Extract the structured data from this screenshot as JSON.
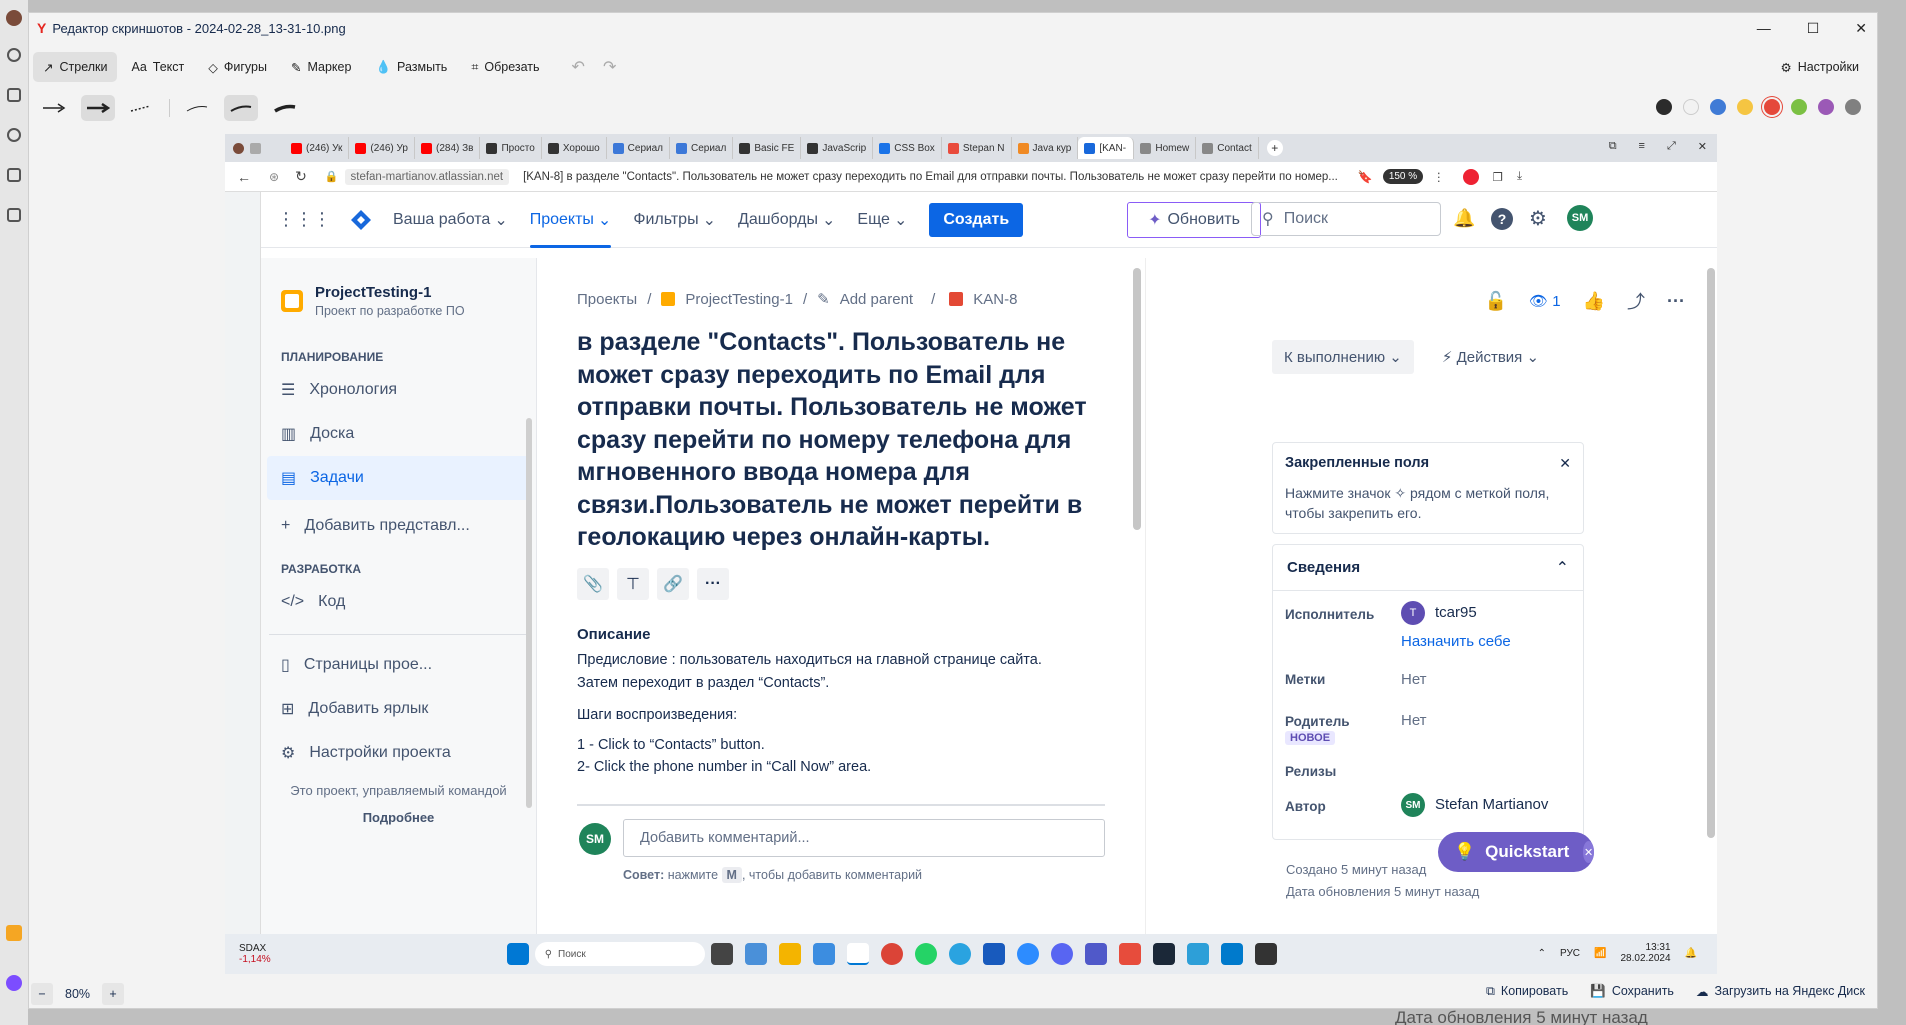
{
  "editor": {
    "title": "Редактор скриншотов - 2024-02-28_13-31-10.png",
    "tools": [
      "Стрелки",
      "Текст",
      "Фигуры",
      "Маркер",
      "Размыть",
      "Обрезать"
    ],
    "settings_label": "Настройки",
    "zoom": "80%",
    "copy_label": "Копировать",
    "save_label": "Сохранить",
    "upload_label": "Загрузить на Яндекс Диск",
    "colors": [
      "#2b2b2b",
      "#f2f2f2",
      "#3f7bd6",
      "#f5c542",
      "#e5483a",
      "#7bc043",
      "#9b59b6",
      "#808080"
    ]
  },
  "browser": {
    "tabs": [
      "(246) Ук",
      "(246) Ур",
      "(284) Зв",
      "Просто",
      "Хорошо",
      "Сериал",
      "Сериал",
      "Basic FE",
      "JavaScrip",
      "CSS Box",
      "Stepan N",
      "Java кур",
      "[KAN-",
      "Homew",
      "Contact"
    ],
    "active_tab": 12,
    "url_host": "stefan-martianov.atlassian.net",
    "url_title": "[KAN-8] в разделе \"Contacts\". Пользователь не может сразу переходить по Email для отправки почты. Пользователь не может сразу перейти по номер...",
    "zoom": "150 %"
  },
  "nav": {
    "your_work": "Ваша работа",
    "projects": "Проекты",
    "filters": "Фильтры",
    "dashboards": "Дашборды",
    "more": "Еще",
    "create": "Создать",
    "upgrade": "Обновить",
    "search_placeholder": "Поиск",
    "avatar": "SM"
  },
  "sidebar": {
    "project_name": "ProjectTesting-1",
    "project_sub": "Проект по разработке ПО",
    "planning": "ПЛАНИРОВАНИЕ",
    "items": [
      "Хронология",
      "Доска",
      "Задачи",
      "Добавить представл..."
    ],
    "dev": "РАЗРАБОТКА",
    "code": "Код",
    "pages": "Страницы прое...",
    "add_shortcut": "Добавить ярлык",
    "settings": "Настройки проекта",
    "team_note": "Это проект, управляемый командой",
    "learn_more": "Подробнее"
  },
  "issue": {
    "crumb_projects": "Проекты",
    "crumb_project": "ProjectTesting-1",
    "crumb_parent": "Add parent",
    "crumb_key": "KAN-8",
    "title": "в разделе \"Contacts\". Пользователь не может сразу переходить по Email для отправки почты. Пользователь не может сразу перейти по номеру телефона для мгновенного ввода номера для связи.Пользователь не может перейти в геолокацию через онлайн-карты.",
    "desc_heading": "Описание",
    "desc_p1": "Предисловие : пользователь находиться на главной странице сайта. Затем переходит в раздел “Contacts”.",
    "desc_p2": "Шаги воспроизведения:",
    "step1": "1 - Click to “Contacts” button.",
    "step2": "2- Click  the phone number in “Call Now” area.",
    "comment_placeholder": "Добавить комментарий...",
    "tip_prefix": "Совет:",
    "tip_mid": " нажмите ",
    "tip_key": "M",
    "tip_suffix": ", чтобы добавить комментарий",
    "avatar": "SM"
  },
  "details": {
    "watch_count": "1",
    "status": "К выполнению",
    "actions": "Действия",
    "pinned_title": "Закрепленные поля",
    "pinned_text": "Нажмите значок ✧ рядом с меткой поля, чтобы закрепить его.",
    "info_title": "Сведения",
    "assignee_label": "Исполнитель",
    "assignee": "tcar95",
    "assignee_avatar": "T",
    "assign_me": "Назначить себе",
    "labels_label": "Метки",
    "labels_val": "Нет",
    "parent_label": "Родитель",
    "new_badge": "НОВОЕ",
    "parent_val": "Нет",
    "releases_label": "Релизы",
    "author_label": "Автор",
    "author": "Stefan Martianov",
    "author_avatar": "SM",
    "created": "Создано 5 минут назад",
    "updated": "Дата обновления 5 минут назад",
    "quickstart": "Quickstart"
  },
  "taskbar": {
    "ticker": "SDAX",
    "ticker_change": "-1,14%",
    "search": "Поиск",
    "lang": "РУС",
    "time": "13:31",
    "date": "28.02.2024"
  },
  "outside": {
    "updated_bg": "Дата обновления 5 минут назад"
  }
}
